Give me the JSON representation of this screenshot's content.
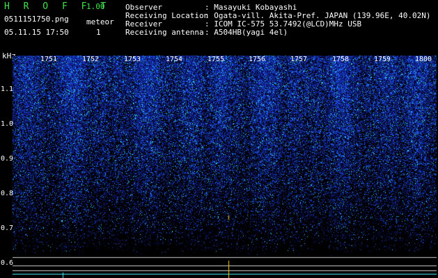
{
  "header": {
    "app_title": "H R O F F T",
    "version": "1.00",
    "filename": "0511151750.png",
    "datetime": "05.11.15 17:50",
    "meteor_label": "meteor",
    "meteor_count": "1"
  },
  "info": {
    "rows": [
      {
        "label": "Observer",
        "value": ": Masayuki Kobayashi"
      },
      {
        "label": "Receiving Location",
        "value": ": Ogata-vill. Akita-Pref. JAPAN (139.96E, 40.02N)"
      },
      {
        "label": "Receiver",
        "value": ": ICOM IC-575 53.7492(@LCD)MHz USB"
      },
      {
        "label": "Receiving antenna",
        "value": ": A504HB(yagi 4el)"
      }
    ]
  },
  "axes": {
    "y_unit": "kHz",
    "y_ticks": [
      "1.1",
      "1.0",
      "0.9",
      "0.8",
      "0.7",
      "0.6"
    ],
    "x_ticks": [
      "1751",
      "1752",
      "1753",
      "1754",
      "1755",
      "1756",
      "1757",
      "1758",
      "1759",
      "1800"
    ]
  },
  "colors": {
    "background": "#000000",
    "noise_low": "#0a1a7a",
    "noise_high": "#2d6bff",
    "speck": "#3ff0ff",
    "meteor": "#ffd21a",
    "labels": "#ffffff",
    "accent": "#3fe34a"
  }
}
